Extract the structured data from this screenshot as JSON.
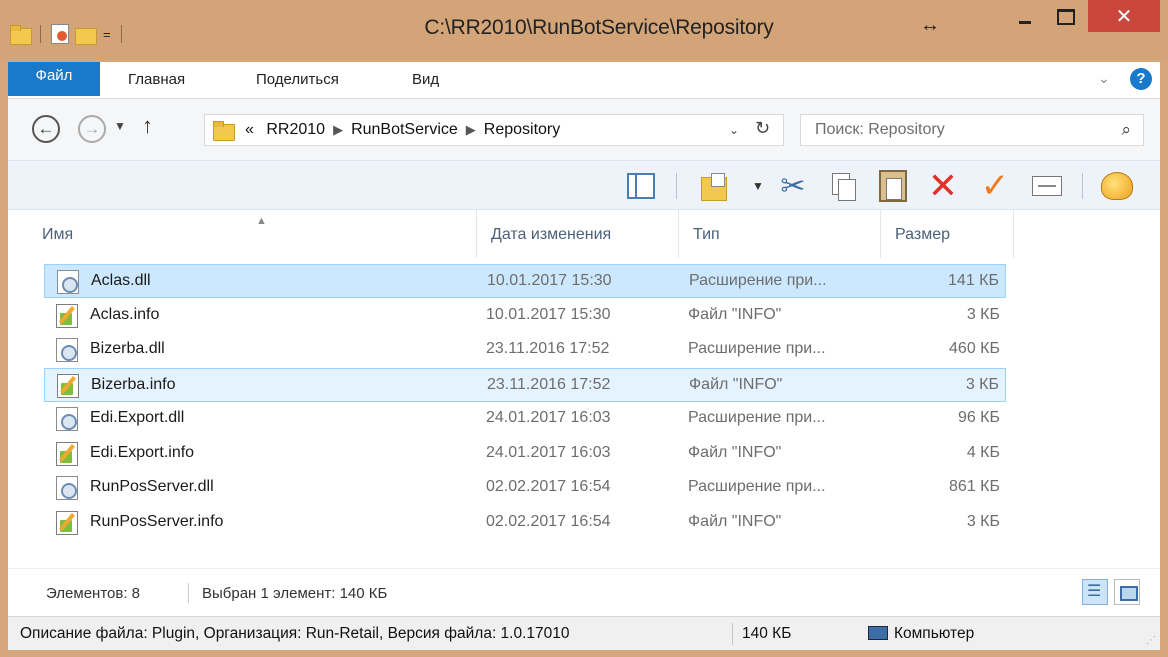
{
  "window": {
    "title": "C:\\RR2010\\RunBotService\\Repository",
    "close_glyph": "✕"
  },
  "qat": {
    "dropdown_glyph": "="
  },
  "ribbon": {
    "tabs": [
      {
        "label": "Файл"
      },
      {
        "label": "Главная"
      },
      {
        "label": "Поделиться"
      },
      {
        "label": "Вид"
      }
    ],
    "help_glyph": "?"
  },
  "address": {
    "overflow": "«",
    "crumbs": [
      "RR2010",
      "RunBotService",
      "Repository"
    ]
  },
  "search": {
    "placeholder": "Поиск: Repository"
  },
  "columns": {
    "name": "Имя",
    "date": "Дата изменения",
    "type": "Тип",
    "size": "Размер"
  },
  "files": [
    {
      "name": "Aclas.dll",
      "date": "10.01.2017 15:30",
      "type": "Расширение при...",
      "size": "141 КБ",
      "kind": "dll",
      "state": "selected"
    },
    {
      "name": "Aclas.info",
      "date": "10.01.2017 15:30",
      "type": "Файл \"INFO\"",
      "size": "3 КБ",
      "kind": "info",
      "state": ""
    },
    {
      "name": "Bizerba.dll",
      "date": "23.11.2016 17:52",
      "type": "Расширение при...",
      "size": "460 КБ",
      "kind": "dll",
      "state": ""
    },
    {
      "name": "Bizerba.info",
      "date": "23.11.2016 17:52",
      "type": "Файл \"INFO\"",
      "size": "3 КБ",
      "kind": "info",
      "state": "hover"
    },
    {
      "name": "Edi.Export.dll",
      "date": "24.01.2017 16:03",
      "type": "Расширение при...",
      "size": "96 КБ",
      "kind": "dll",
      "state": ""
    },
    {
      "name": "Edi.Export.info",
      "date": "24.01.2017 16:03",
      "type": "Файл \"INFO\"",
      "size": "4 КБ",
      "kind": "info",
      "state": ""
    },
    {
      "name": "RunPosServer.dll",
      "date": "02.02.2017 16:54",
      "type": "Расширение при...",
      "size": "861 КБ",
      "kind": "dll",
      "state": ""
    },
    {
      "name": "RunPosServer.info",
      "date": "02.02.2017 16:54",
      "type": "Файл \"INFO\"",
      "size": "3 КБ",
      "kind": "info",
      "state": ""
    }
  ],
  "status": {
    "count": "Элементов: 8",
    "selection": "Выбран 1 элемент: 140 КБ"
  },
  "statusbar": {
    "description": "Описание файла: Plugin, Организация: Run-Retail, Версия файла: 1.0.17010",
    "size": "140 КБ",
    "location": "Компьютер"
  },
  "colors": {
    "accent": "#1979ca",
    "selection": "#cce8ff",
    "close_red": "#c9463d"
  }
}
